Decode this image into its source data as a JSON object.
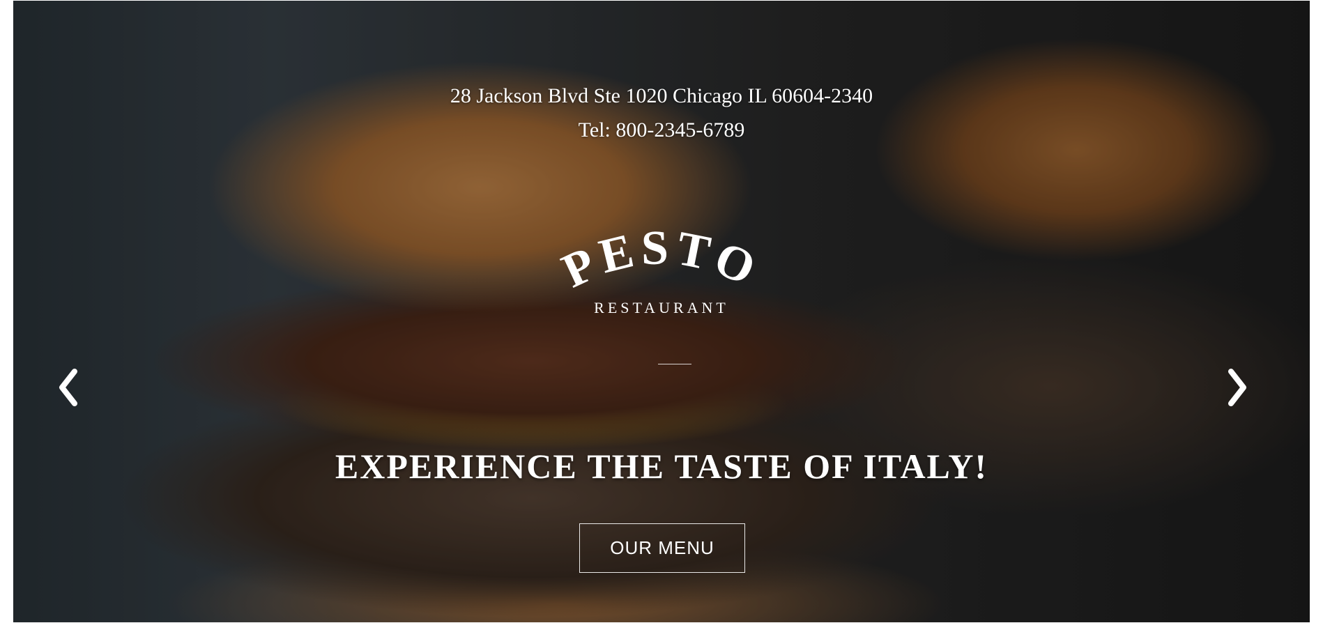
{
  "hero": {
    "address": "28 Jackson Blvd Ste 1020 Chicago IL 60604-2340",
    "phone": "Tel: 800-2345-6789",
    "logo": {
      "name": "PESTO",
      "subtitle": "RESTAURANT"
    },
    "tagline": "EXPERIENCE THE TASTE OF ITALY!",
    "button_label": "OUR MENU",
    "prev_icon": "chevron-left-icon",
    "next_icon": "chevron-right-icon",
    "text_color": "#ffffff"
  }
}
